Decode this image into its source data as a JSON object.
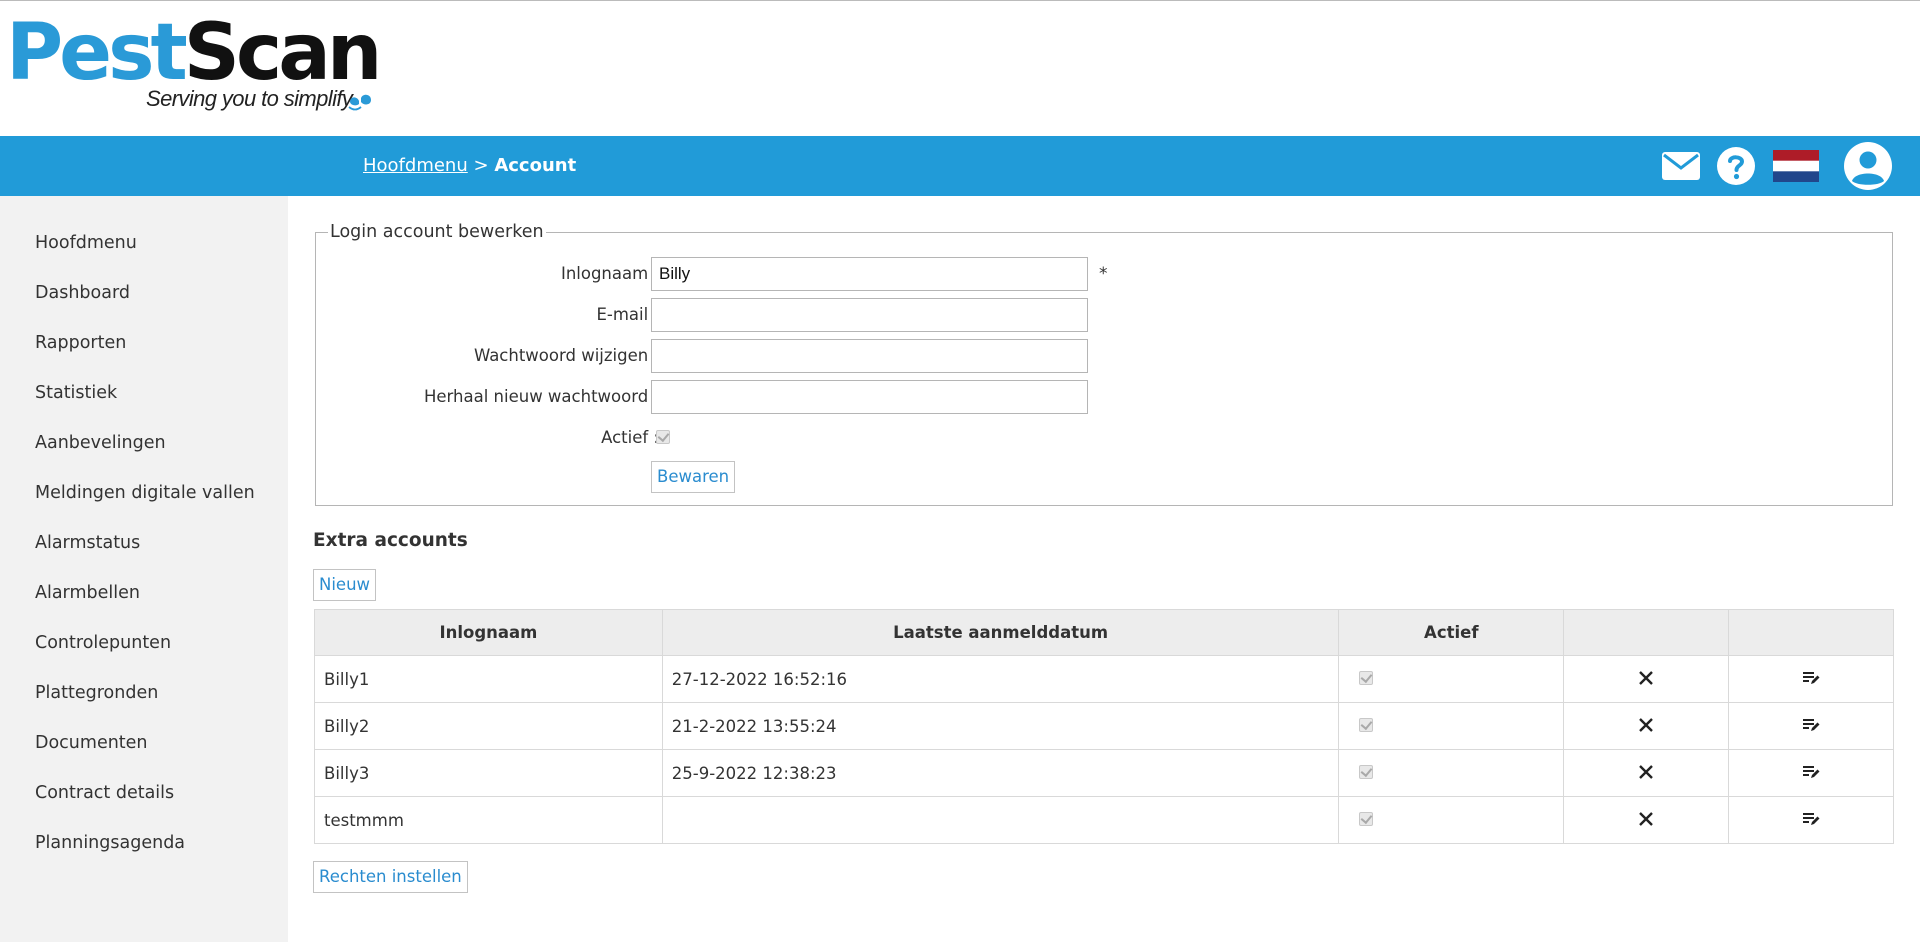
{
  "logo": {
    "brand_part1": "Pest",
    "brand_part2": "Scan",
    "tagline": "Serving you to simplify"
  },
  "breadcrumb": {
    "parent": "Hoofdmenu",
    "separator": ">",
    "current": "Account"
  },
  "header_icons": [
    "mail-icon",
    "help-icon",
    "flag-nl-icon",
    "user-account-icon"
  ],
  "sidebar": {
    "items": [
      {
        "label": "Hoofdmenu"
      },
      {
        "label": "Dashboard"
      },
      {
        "label": "Rapporten"
      },
      {
        "label": "Statistiek"
      },
      {
        "label": "Aanbevelingen"
      },
      {
        "label": "Meldingen digitale vallen"
      },
      {
        "label": "Alarmstatus"
      },
      {
        "label": "Alarmbellen"
      },
      {
        "label": "Controlepunten"
      },
      {
        "label": "Plattegronden"
      },
      {
        "label": "Documenten"
      },
      {
        "label": "Contract details"
      },
      {
        "label": "Planningsagenda"
      }
    ]
  },
  "login_form": {
    "legend": "Login account bewerken",
    "username_label": "Inlognaam :",
    "username_value": "Billy",
    "required_marker": "*",
    "email_label": "E-mail :",
    "email_value": "",
    "password_label": "Wachtwoord wijzigen :",
    "password_value": "",
    "repeat_password_label": "Herhaal nieuw wachtwoord :",
    "repeat_password_value": "",
    "active_label": "Actief :",
    "active_checked": true,
    "save_label": "Bewaren"
  },
  "extra_accounts": {
    "title": "Extra accounts",
    "new_label": "Nieuw",
    "columns": [
      "Inlognaam",
      "Laatste aanmelddatum",
      "Actief",
      "",
      ""
    ],
    "rows": [
      {
        "username": "Billy1",
        "last_login": "27-12-2022 16:52:16",
        "active": true
      },
      {
        "username": "Billy2",
        "last_login": "21-2-2022 13:55:24",
        "active": true
      },
      {
        "username": "Billy3",
        "last_login": "25-9-2022 12:38:23",
        "active": true
      },
      {
        "username": "testmmm",
        "last_login": "",
        "active": true
      }
    ],
    "rights_label": "Rechten instellen"
  },
  "colors": {
    "nav_bar": "#219bd8",
    "brand_blue": "#2a9ad7",
    "sidebar_bg": "#f2f2f2",
    "link_blue": "#2a8ccf"
  }
}
